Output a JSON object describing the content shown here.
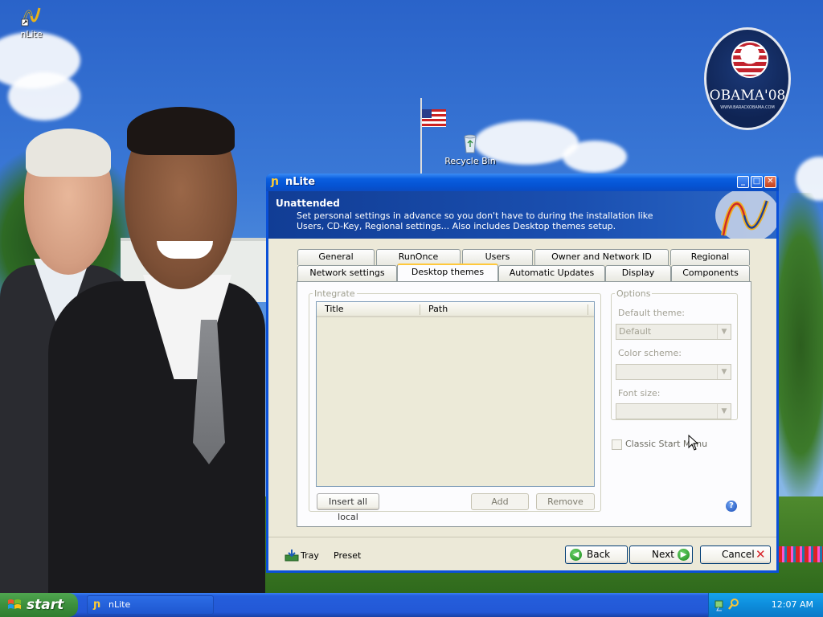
{
  "desktop": {
    "icons": [
      {
        "label": "nLite",
        "icon": "nlite-icon"
      },
      {
        "label": "Recycle Bin",
        "icon": "recycle-bin-icon"
      }
    ],
    "wallpaper_logo": {
      "name": "OBAMA'08",
      "site": "WWW.BARACKOBAMA.COM"
    }
  },
  "window": {
    "title": "nLite",
    "buttons": {
      "minimize": "_",
      "maximize": "□",
      "close": "✕"
    },
    "header": {
      "title": "Unattended",
      "description": "Set personal settings in advance so you don't have to during the installation like Users, CD-Key, Regional settings... Also includes Desktop themes setup."
    },
    "tabs_row1": [
      "General",
      "RunOnce",
      "Users",
      "Owner and Network ID",
      "Regional"
    ],
    "tabs_row2": [
      "Network settings",
      "Desktop themes",
      "Automatic Updates",
      "Display",
      "Components"
    ],
    "active_tab": "Desktop themes",
    "integrate": {
      "legend": "Integrate",
      "columns": [
        "Title",
        "Path"
      ],
      "rows": [],
      "buttons": {
        "insert_all_local": "Insert all local",
        "add": "Add",
        "remove": "Remove"
      }
    },
    "options": {
      "legend": "Options",
      "default_theme_label": "Default theme:",
      "default_theme_value": "Default",
      "color_scheme_label": "Color scheme:",
      "color_scheme_value": "",
      "font_size_label": "Font size:",
      "font_size_value": "",
      "classic_start_menu_label": "Classic Start Menu",
      "classic_start_menu_checked": false
    },
    "help": "?",
    "footer": {
      "tray_label": "Tray",
      "preset_label": "Preset",
      "back_label": "Back",
      "next_label": "Next",
      "cancel_label": "Cancel"
    }
  },
  "taskbar": {
    "start_label": "start",
    "tasks": [
      {
        "label": "nLite"
      }
    ],
    "clock": "12:07 AM"
  },
  "colors": {
    "xp_blue": "#0a50d8",
    "banner": "#1a4fb0",
    "active_tab_highlight": "#ffc83c",
    "start_green": "#3c8f3c"
  }
}
